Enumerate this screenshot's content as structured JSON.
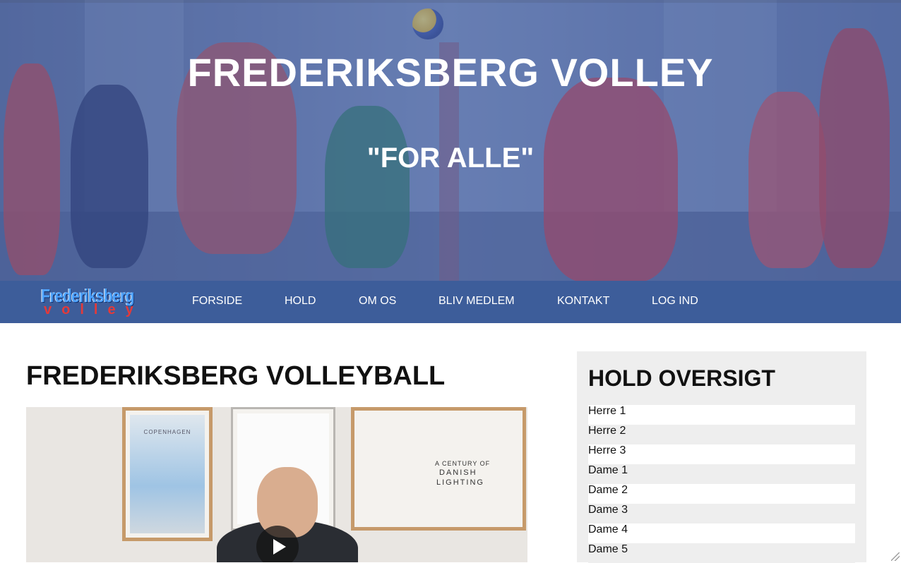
{
  "hero": {
    "title": "FREDERIKSBERG VOLLEY",
    "subtitle": "\"FOR ALLE\""
  },
  "logo": {
    "line1": "Frederiksberg",
    "line2": "volley"
  },
  "nav": {
    "items": [
      "FORSIDE",
      "HOLD",
      "OM OS",
      "BLIV MEDLEM",
      "KONTAKT",
      "LOG IND"
    ]
  },
  "main": {
    "title": "FREDERIKSBERG VOLLEYBALL",
    "video": {
      "poster_texts": [
        "COPENHAGEN",
        "A CENTURY OF",
        "DANISH",
        "LIGHTING"
      ]
    }
  },
  "sidebar": {
    "title": "HOLD OVERSIGT",
    "teams": [
      "Herre 1",
      "Herre 2",
      "Herre 3",
      "Dame 1",
      "Dame 2",
      "Dame 3",
      "Dame 4",
      "Dame 5"
    ]
  },
  "colors": {
    "nav_bg": "#3d5d9a",
    "sidebar_bg": "#eeeeee",
    "hero_overlay": "#465fa0",
    "logo_blue": "#4fa3ff",
    "logo_red": "#e33a3a"
  },
  "icons": {
    "video_play": "play-icon"
  }
}
